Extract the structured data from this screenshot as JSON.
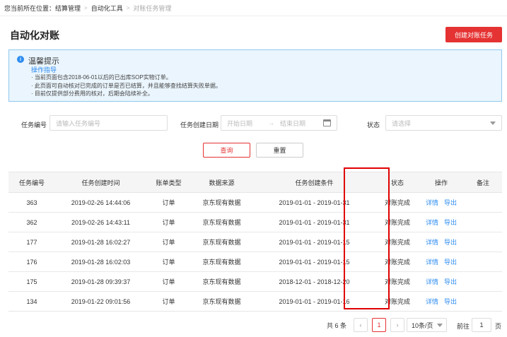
{
  "breadcrumb": {
    "prefix": "您当前所在位置：结算管理",
    "level2": "自动化工具",
    "current": "对账任务管理"
  },
  "page": {
    "title": "自动化对账",
    "create_button": "创建对账任务"
  },
  "notice": {
    "title": "温馨提示",
    "subtitle": "操作指导",
    "lines": [
      "当前页面包含2018-06-01以后的已出库SOP实物订单。",
      "此页面可自动核对已完成的订单是否已结算，并且能够查找结算失败单据。",
      "目前仅提供部分费用的核对，后期会陆续补全。"
    ]
  },
  "filters": {
    "task_no": {
      "label": "任务编号",
      "placeholder": "请输入任务编号"
    },
    "created_date": {
      "label": "任务创建日期",
      "start_placeholder": "开始日期",
      "sep": "→",
      "end_placeholder": "结束日期"
    },
    "status": {
      "label": "状态",
      "placeholder": "请选择"
    },
    "query_button": "查询",
    "reset_button": "重置"
  },
  "table": {
    "columns": [
      "任务编号",
      "任务创建时间",
      "账单类型",
      "数据来源",
      "任务创建条件",
      "状态",
      "操作",
      "备注"
    ],
    "action_detail": "详情",
    "action_export": "导出",
    "rows": [
      {
        "id": "363",
        "created": "2019-02-26 14:44:06",
        "type": "订单",
        "source": "京东现有数据",
        "condition": "2019-01-01 - 2019-01-31",
        "status": "对账完成",
        "note": ""
      },
      {
        "id": "362",
        "created": "2019-02-26 14:43:11",
        "type": "订单",
        "source": "京东现有数据",
        "condition": "2019-01-01 - 2019-01-31",
        "status": "对账完成",
        "note": ""
      },
      {
        "id": "177",
        "created": "2019-01-28 16:02:27",
        "type": "订单",
        "source": "京东现有数据",
        "condition": "2019-01-01 - 2019-01-15",
        "status": "对账完成",
        "note": ""
      },
      {
        "id": "176",
        "created": "2019-01-28 16:02:03",
        "type": "订单",
        "source": "京东现有数据",
        "condition": "2019-01-01 - 2019-01-15",
        "status": "对账完成",
        "note": ""
      },
      {
        "id": "175",
        "created": "2019-01-28 09:39:37",
        "type": "订单",
        "source": "京东现有数据",
        "condition": "2018-12-01 - 2018-12-20",
        "status": "对账完成",
        "note": ""
      },
      {
        "id": "134",
        "created": "2019-01-22 09:01:56",
        "type": "订单",
        "source": "京东现有数据",
        "condition": "2019-01-01 - 2019-01-16",
        "status": "对账完成",
        "note": ""
      }
    ]
  },
  "pagination": {
    "total": "共 6 条",
    "prev": "‹",
    "current_page": "1",
    "next": "›",
    "page_size": "10条/页",
    "goto_label": "前往",
    "goto_value": "1",
    "goto_suffix": "页"
  },
  "colors": {
    "accent": "#e53232",
    "link": "#2d8cf0",
    "success": "#22b14c",
    "notice_bg": "#eaf5fd",
    "highlight": "#e00000"
  }
}
